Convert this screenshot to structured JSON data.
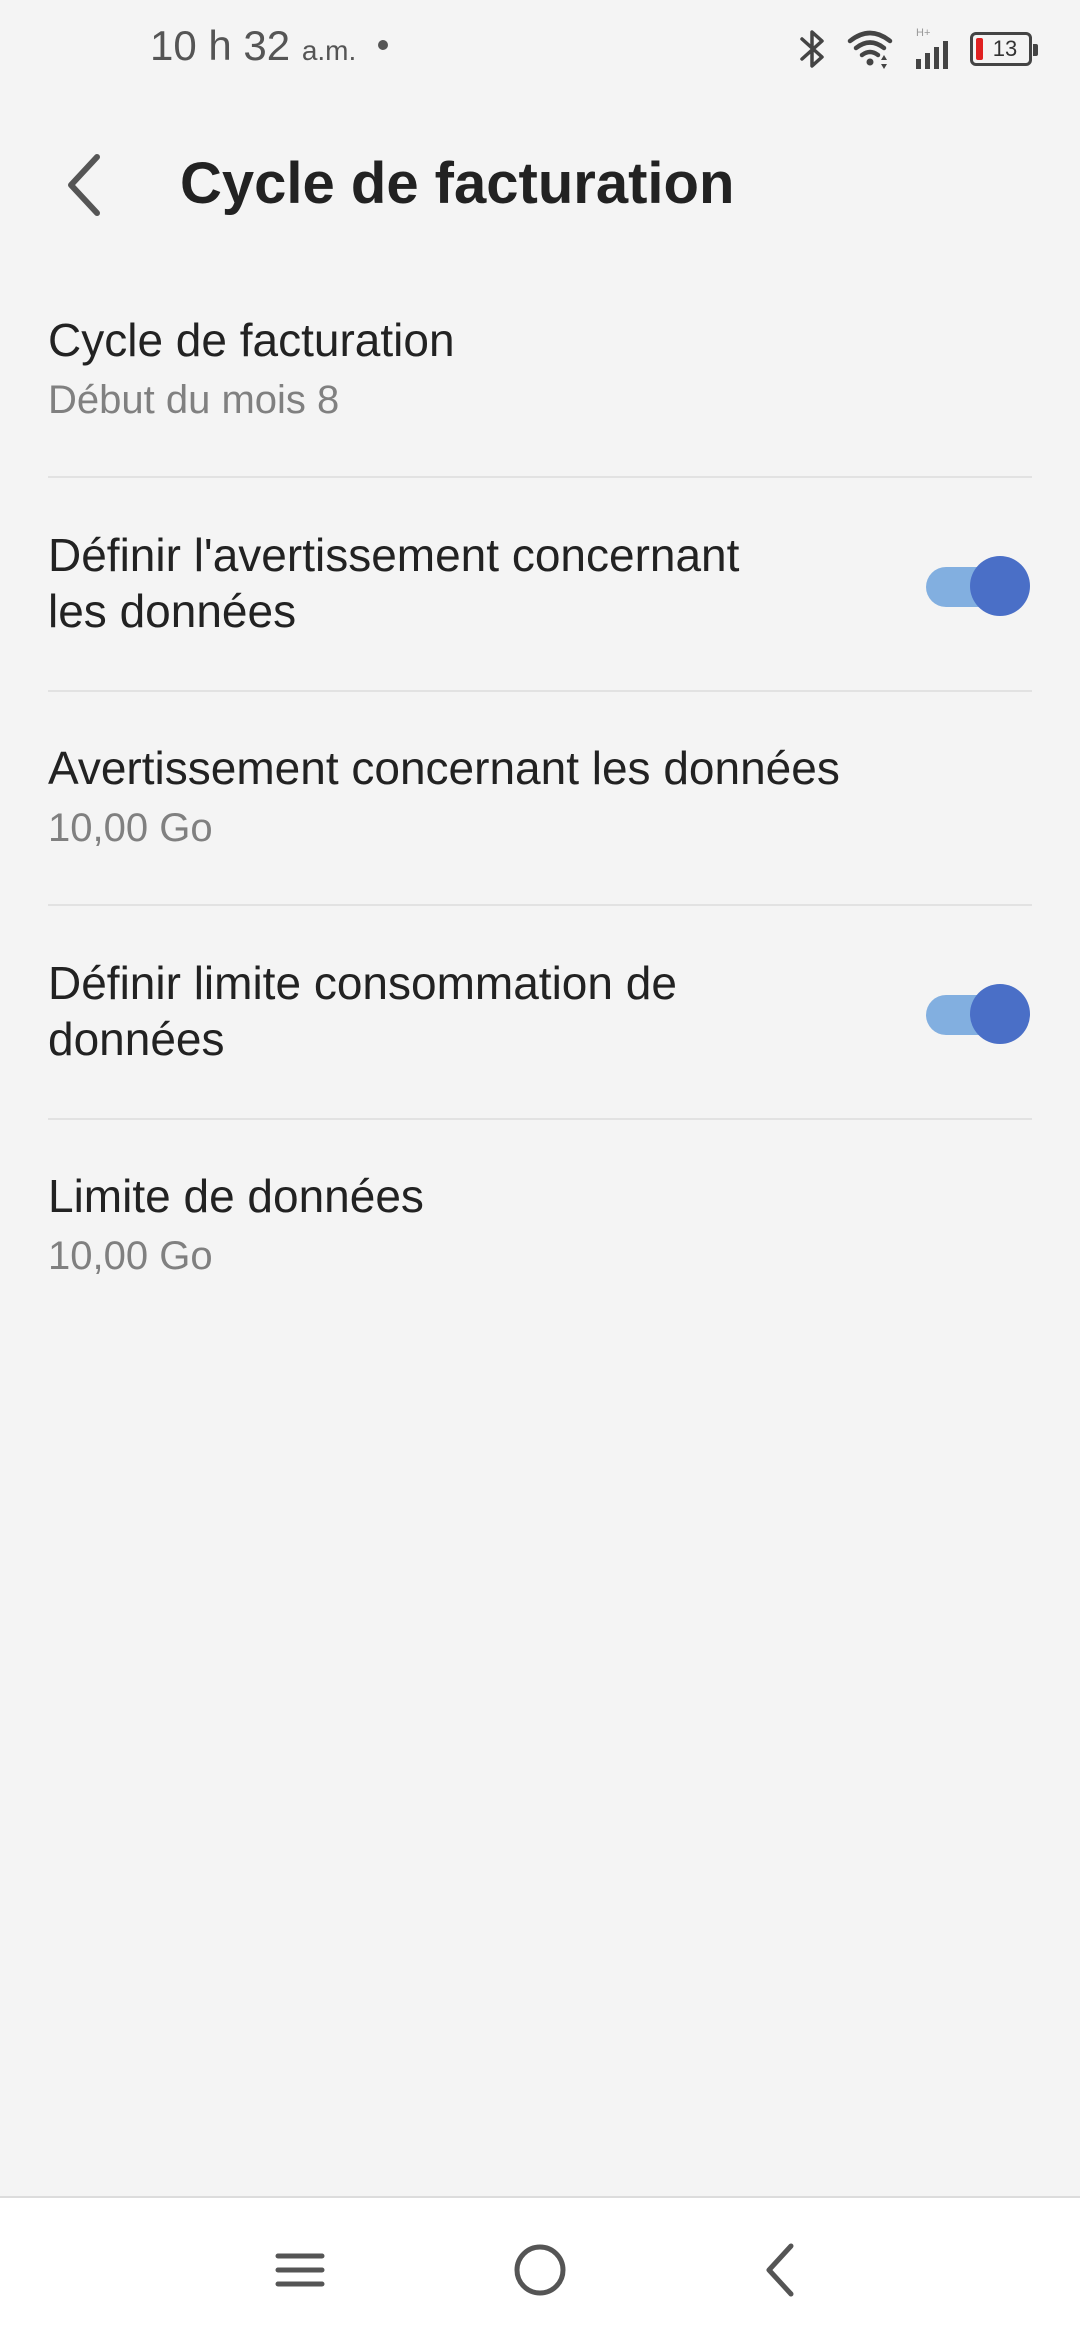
{
  "status_bar": {
    "time": "10 h 32",
    "ampm": "a.m.",
    "network_label": "H+",
    "battery_level": "13",
    "icons": [
      "bluetooth-icon",
      "wifi-icon",
      "cellular-signal-icon",
      "battery-icon"
    ]
  },
  "app_bar": {
    "title": "Cycle de facturation",
    "back_icon": "back-arrow-icon"
  },
  "settings": [
    {
      "title": "Cycle de facturation",
      "subtitle": "Début du mois 8"
    },
    {
      "title": "Définir l'avertissement concernant les données",
      "toggle": true
    },
    {
      "title": "Avertissement concernant les données",
      "subtitle": "10,00 Go"
    },
    {
      "title": "Définir limite consommation de données",
      "toggle": true
    },
    {
      "title": "Limite de données",
      "subtitle": "10,00 Go"
    }
  ],
  "nav_bar": {
    "icons": [
      "menu-icon",
      "home-icon",
      "back-icon"
    ]
  },
  "colors": {
    "background": "#f4f4f4",
    "toggle_track": "#82afe0",
    "toggle_thumb": "#4a6fc7",
    "battery_low": "#e02020"
  }
}
